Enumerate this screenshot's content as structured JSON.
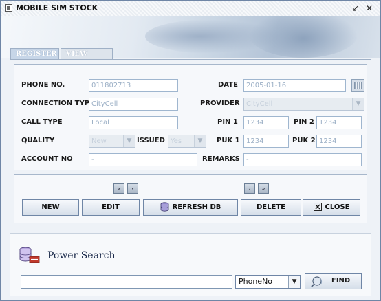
{
  "window": {
    "title": "MOBILE SIM STOCK"
  },
  "tabs": [
    {
      "label": "REGISTER",
      "active": true
    },
    {
      "label": "VIEW DATA",
      "active": false
    }
  ],
  "form": {
    "phone_no": {
      "label": "PHONE NO.",
      "value": "011802713"
    },
    "date": {
      "label": "DATE",
      "value": "2005-01-16"
    },
    "connection_type": {
      "label": "CONNECTION TYPE",
      "value": "CityCell"
    },
    "provider": {
      "label": "PROVIDER",
      "value": "CityCell"
    },
    "call_type": {
      "label": "CALL TYPE",
      "value": "Local"
    },
    "pin1": {
      "label": "PIN 1",
      "value": "1234"
    },
    "pin2": {
      "label": "PIN 2",
      "value": "1234"
    },
    "quality": {
      "label": "QUALITY",
      "value": "New"
    },
    "issued": {
      "label": "ISSUED",
      "value": "Yes"
    },
    "puk1": {
      "label": "PUK 1",
      "value": "1234"
    },
    "puk2": {
      "label": "PUK 2",
      "value": "1234"
    },
    "account_no": {
      "label": "ACCOUNT NO",
      "value": "-"
    },
    "remarks": {
      "label": "REMARKS",
      "value": "-"
    }
  },
  "nav": {
    "first": "«",
    "prev": "‹",
    "next": "›",
    "last": "»"
  },
  "buttons": {
    "new": "NEW",
    "edit": "EDIT",
    "refresh": "REFRESH DB",
    "delete": "DELETE",
    "close": "CLOSE"
  },
  "search": {
    "title": "Power Search",
    "query": "",
    "field": "PhoneNo",
    "find": "FIND"
  },
  "icons": {
    "app": "window-icon",
    "database": "database-icon",
    "close": "close-box-icon",
    "find": "search-icon",
    "power_search": "database-search-icon"
  },
  "colors": {
    "border": "#6f86a6",
    "field_text": "#9cb0c6",
    "tab_active": "#c7d6e8"
  }
}
